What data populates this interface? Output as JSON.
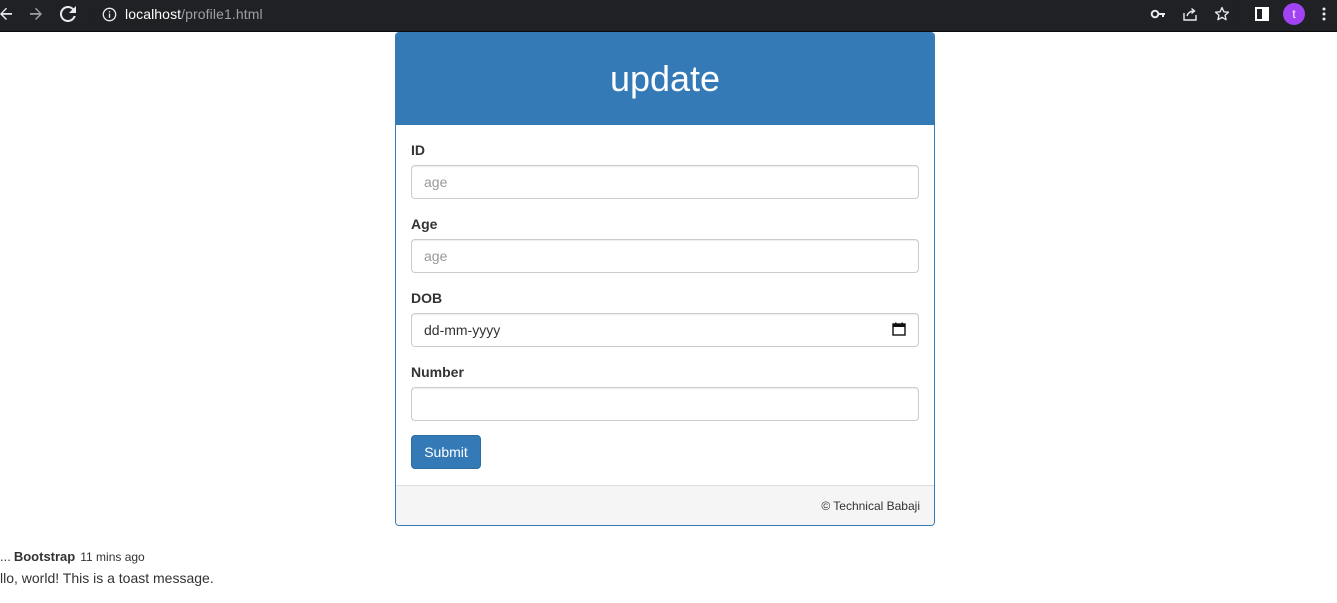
{
  "browser": {
    "url_host": "localhost",
    "url_path": "/profile1.html",
    "avatar_letter": "t",
    "icons": [
      "back-icon",
      "forward-icon",
      "reload-icon",
      "info-icon",
      "key-icon",
      "share-icon",
      "star-icon",
      "sidepanel-icon",
      "more-icon"
    ],
    "avatar_color": "#a142f4"
  },
  "panel": {
    "title": "update",
    "accent_color": "#337ab7",
    "fields": [
      {
        "label": "ID",
        "placeholder": "age",
        "value": ""
      },
      {
        "label": "Age",
        "placeholder": "age",
        "value": ""
      },
      {
        "label": "DOB",
        "placeholder": "dd-mm-yyyy",
        "value": ""
      },
      {
        "label": "Number",
        "placeholder": "",
        "value": ""
      }
    ],
    "submit_label": "Submit",
    "footer_text": "© Technical Babaji"
  },
  "toast": {
    "ellipsis": "...",
    "title": "Bootstrap",
    "time": "11 mins ago",
    "message": "llo, world! This is a toast message."
  }
}
